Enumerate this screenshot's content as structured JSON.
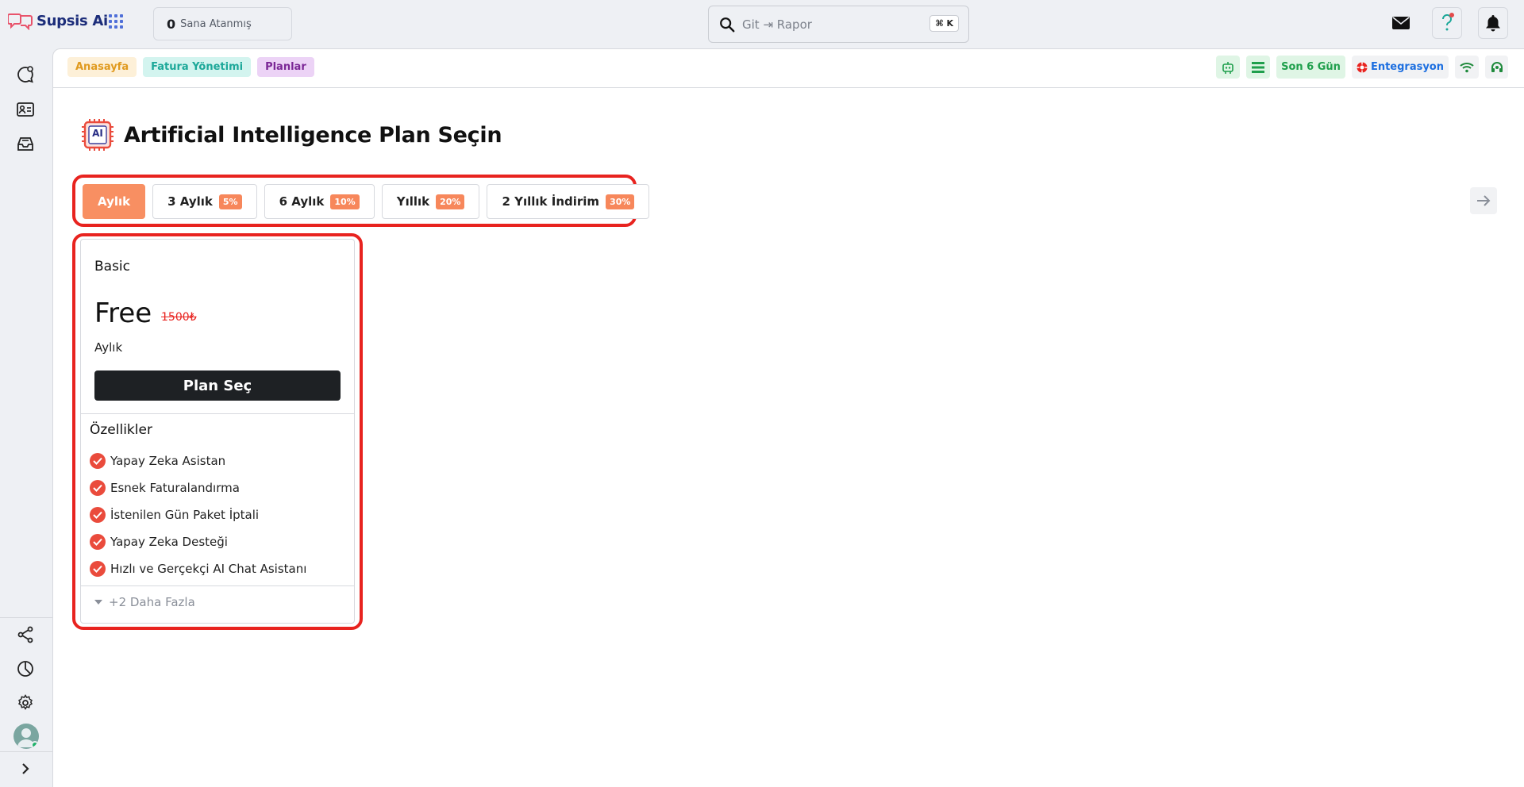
{
  "app": {
    "brand": "Supsis Ai",
    "brand_color": "#1c2d7a"
  },
  "topbar": {
    "assigned_count": "0",
    "assigned_label": "Sana Atanmış",
    "search_placeholder": "Git ⇥ Rapor",
    "search_shortcut": "⌘ K",
    "icons": [
      "mail-icon",
      "help-icon",
      "bell-icon"
    ]
  },
  "sidebar": {
    "top_icons": [
      "chat-icon",
      "contact-card-icon",
      "inbox-icon"
    ],
    "bottom_icons": [
      "share-icon",
      "pie-chart-icon",
      "gear-icon",
      "avatar",
      "chevron-right-icon"
    ]
  },
  "breadcrumbs": {
    "home": "Anasayfa",
    "billing": "Fatura Yönetimi",
    "plans": "Planlar"
  },
  "status": {
    "days_left": "Son 6 Gün",
    "integration": "Entegrasyon"
  },
  "page": {
    "title": "Artificial Intelligence Plan Seçin",
    "title_badge": "AI"
  },
  "tabs": [
    {
      "label": "Aylık",
      "badge": "",
      "active": true
    },
    {
      "label": "3 Aylık",
      "badge": "5%"
    },
    {
      "label": "6 Aylık",
      "badge": "10%"
    },
    {
      "label": "Yıllık",
      "badge": "20%"
    },
    {
      "label": "2 Yıllık İndirim",
      "badge": "30%"
    }
  ],
  "plan": {
    "name": "Basic",
    "price": "Free",
    "old_price": "1500₺",
    "period": "Aylık",
    "button": "Plan Seç",
    "features_title": "Özellikler",
    "features": [
      "Yapay Zeka Asistan",
      "Esnek Faturalandırma",
      "İstenilen Gün Paket İptali",
      "Yapay Zeka Desteği",
      "Hızlı ve Gerçekçi AI Chat Asistanı"
    ],
    "more": "+2 Daha Fazla"
  },
  "colors": {
    "accent": "#f88f62",
    "highlight": "#e8231f",
    "check": "#ea4b3c"
  }
}
